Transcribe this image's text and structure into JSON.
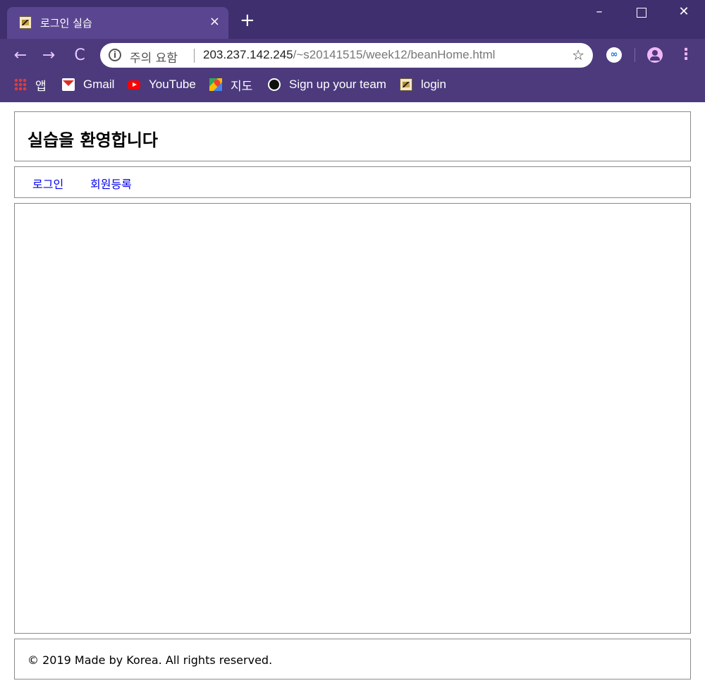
{
  "browser": {
    "tab_title": "로그인 실습",
    "tab_close": "×",
    "new_tab": "+",
    "window_controls": {
      "minimize": "–",
      "close": "✕"
    },
    "nav": {
      "back": "←",
      "forward": "→",
      "reload": "C"
    },
    "address": {
      "info_glyph": "i",
      "security_label": "주의 요함",
      "host": "203.237.142.245",
      "path": "/~s20141515/week12/beanHome.html"
    },
    "bookmark_star": "☆",
    "extension_label": "∞",
    "menu_glyph": "⋮",
    "bookmarks": [
      {
        "label": "앱",
        "icon": "apps-icon"
      },
      {
        "label": "Gmail",
        "icon": "gmail-icon"
      },
      {
        "label": "YouTube",
        "icon": "youtube-icon"
      },
      {
        "label": "지도",
        "icon": "maps-icon"
      },
      {
        "label": "Sign up your team",
        "icon": "github-icon"
      },
      {
        "label": "login",
        "icon": "login-favicon-icon"
      }
    ]
  },
  "page": {
    "header_title": "실습을 환영합니다",
    "nav_links": [
      "로그인",
      "회원등록"
    ],
    "footer_text": "© 2019 Made by Korea. All rights reserved."
  }
}
